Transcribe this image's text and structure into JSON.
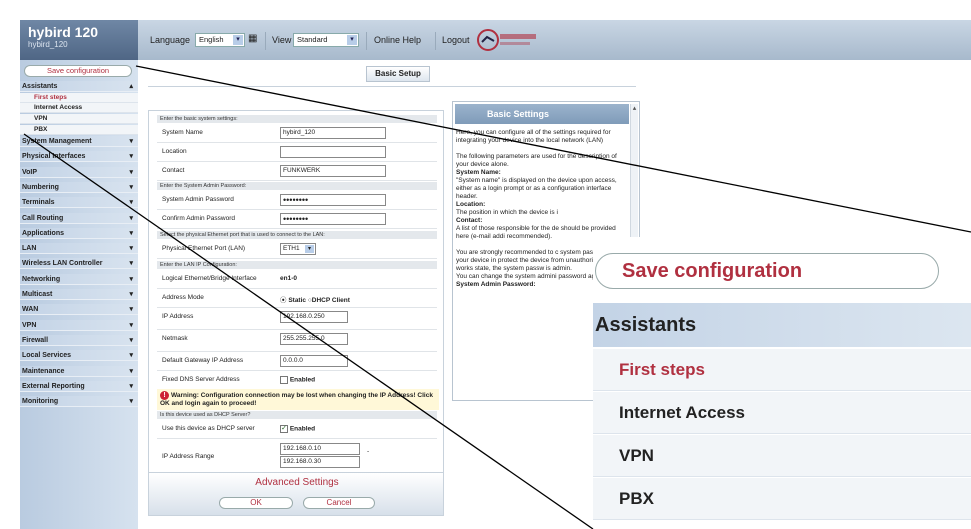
{
  "brand": {
    "title": "hybird 120",
    "subtitle": "hybird_120"
  },
  "topbar": {
    "language_label": "Language",
    "language_value": "English",
    "view_label": "View",
    "view_value": "Standard",
    "online_help": "Online Help",
    "logout": "Logout"
  },
  "sidebar": {
    "save": "Save configuration",
    "assistants": "Assistants",
    "assistant_items": [
      "First steps",
      "Internet Access",
      "VPN",
      "PBX"
    ],
    "menus": [
      "System Management",
      "Physical Interfaces",
      "VoIP",
      "Numbering",
      "Terminals",
      "Call Routing",
      "Applications",
      "LAN",
      "Wireless LAN Controller",
      "Networking",
      "Multicast",
      "WAN",
      "VPN",
      "Firewall",
      "Local Services",
      "Maintenance",
      "External Reporting",
      "Monitoring"
    ]
  },
  "page_title": "Basic Setup",
  "form": {
    "sec1": "Enter the basic system settings:",
    "system_name_label": "System Name",
    "system_name": "hybird_120",
    "location_label": "Location",
    "location": "",
    "contact_label": "Contact",
    "contact": "FUNKWERK",
    "sec2": "Enter the System Admin Password:",
    "admin_pw_label": "System Admin Password",
    "admin_pw": "••••••••",
    "confirm_pw_label": "Confirm Admin Password",
    "confirm_pw": "••••••••",
    "sec3": "Select the physical Ethernet port that is used to connect to the LAN:",
    "phys_port_label": "Physical Ethernet Port (LAN)",
    "phys_port": "ETH1",
    "sec4": "Enter the LAN IP Configuration:",
    "logical_label": "Logical Ethernet/Bridge Interface",
    "logical": "en1-0",
    "addr_mode_label": "Address Mode",
    "static": "Static",
    "dhcp_client": "DHCP Client",
    "ip_label": "IP Address",
    "ip": "192.168.0.250",
    "netmask_label": "Netmask",
    "netmask": "255.255.255.0",
    "gateway_label": "Default Gateway IP Address",
    "gateway": "0.0.0.0",
    "dns_label": "Fixed DNS Server Address",
    "enabled": "Enabled",
    "warning": "Warning: Configuration connection may be lost when changing the IP Address! Click OK and login again to proceed!",
    "sec5": "Is this device used as DHCP Server?",
    "dhcp_label": "Use this device as DHCP server",
    "range_label": "IP Address Range",
    "range_start": "192.168.0.10",
    "range_end": "192.168.0.30",
    "range_dash": "-",
    "advanced": "Advanced Settings",
    "ok": "OK",
    "cancel": "Cancel"
  },
  "help": {
    "title": "Basic Settings",
    "p1": "Here, you can configure all of the settings required for integrating your device into the local network (LAN)",
    "p2": "The following parameters are used for the description of your device alone.",
    "h_system": "System Name:",
    "p3": "\"System name\" is displayed on the device upon access, either as a login prompt or as a configuration interface header.",
    "h_location": "Location:",
    "p4": "The position in which the device is i",
    "h_contact": "Contact:",
    "p5": "A list of those responsible for the de should be provided here (e-mail addi recommended).",
    "p6": "You are strongly recommended to c system password for your device in protect the device from unauthorised In ex works state, the system passw is admin.",
    "p7": "You can change the system admini password again here.",
    "h_admin": "System Admin Password:"
  },
  "zoom": {
    "save": "Save configuration",
    "assistants": "Assistants",
    "items": [
      "First steps",
      "Internet Access",
      "VPN",
      "PBX"
    ]
  }
}
